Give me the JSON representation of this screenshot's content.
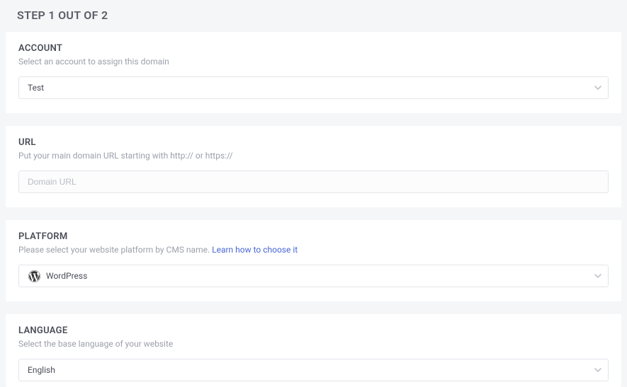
{
  "step_header": "STEP 1 OUT OF 2",
  "account": {
    "title": "ACCOUNT",
    "desc": "Select an account to assign this domain",
    "selected": "Test"
  },
  "url": {
    "title": "URL",
    "desc": "Put your main domain URL starting with http:// or https://",
    "placeholder": "Domain URL"
  },
  "platform": {
    "title": "PLATFORM",
    "desc_prefix": "Please select your website platform by CMS name. ",
    "learn_link": "Learn how to choose it",
    "selected": "WordPress"
  },
  "language": {
    "title": "LANGUAGE",
    "desc": "Select the base language of your website",
    "selected": "English"
  }
}
